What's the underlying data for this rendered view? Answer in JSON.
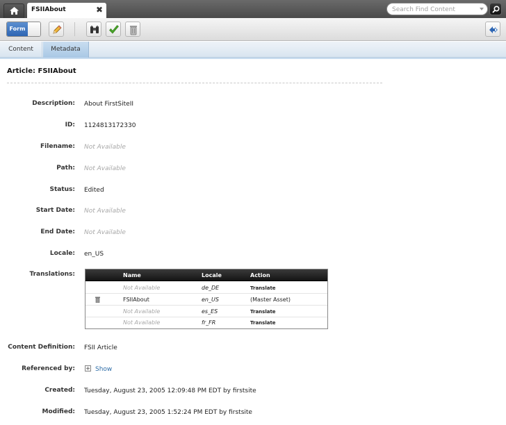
{
  "tab": {
    "title": "FSIIAbout",
    "close": "✖"
  },
  "search": {
    "placeholder": "Search Find Content"
  },
  "toolbar": {
    "form_label": "Form"
  },
  "subtabs": [
    {
      "label": "Content"
    },
    {
      "label": "Metadata"
    }
  ],
  "article": {
    "title": "Article: FSIIAbout"
  },
  "fields": {
    "description": {
      "label": "Description:",
      "value": "About FirstSiteII"
    },
    "id": {
      "label": "ID:",
      "value": "1124813172330"
    },
    "filename": {
      "label": "Filename:",
      "value": "Not Available"
    },
    "path": {
      "label": "Path:",
      "value": "Not Available"
    },
    "status": {
      "label": "Status:",
      "value": "Edited"
    },
    "start_date": {
      "label": "Start Date:",
      "value": "Not Available"
    },
    "end_date": {
      "label": "End Date:",
      "value": "Not Available"
    },
    "locale": {
      "label": "Locale:",
      "value": "en_US"
    },
    "translations": {
      "label": "Translations:"
    },
    "content_definition": {
      "label": "Content Definition:",
      "value": "FSII Article"
    },
    "referenced_by": {
      "label": "Referenced by:",
      "link": "Show",
      "toggle": "+"
    },
    "created": {
      "label": "Created:",
      "value": "Tuesday, August 23, 2005 12:09:48 PM EDT by firstsite"
    },
    "modified": {
      "label": "Modified:",
      "value": "Tuesday, August 23, 2005 1:52:24 PM EDT by firstsite"
    }
  },
  "translations": {
    "headers": {
      "name": "Name",
      "locale": "Locale",
      "action": "Action"
    },
    "rows": [
      {
        "name": "Not Available",
        "locale": "de_DE",
        "action": "Translate"
      },
      {
        "name": "FSIIAbout",
        "locale": "en_US",
        "action": "(Master Asset)"
      },
      {
        "name": "Not Available",
        "locale": "es_ES",
        "action": "Translate"
      },
      {
        "name": "Not Available",
        "locale": "fr_FR",
        "action": "Translate"
      }
    ]
  }
}
